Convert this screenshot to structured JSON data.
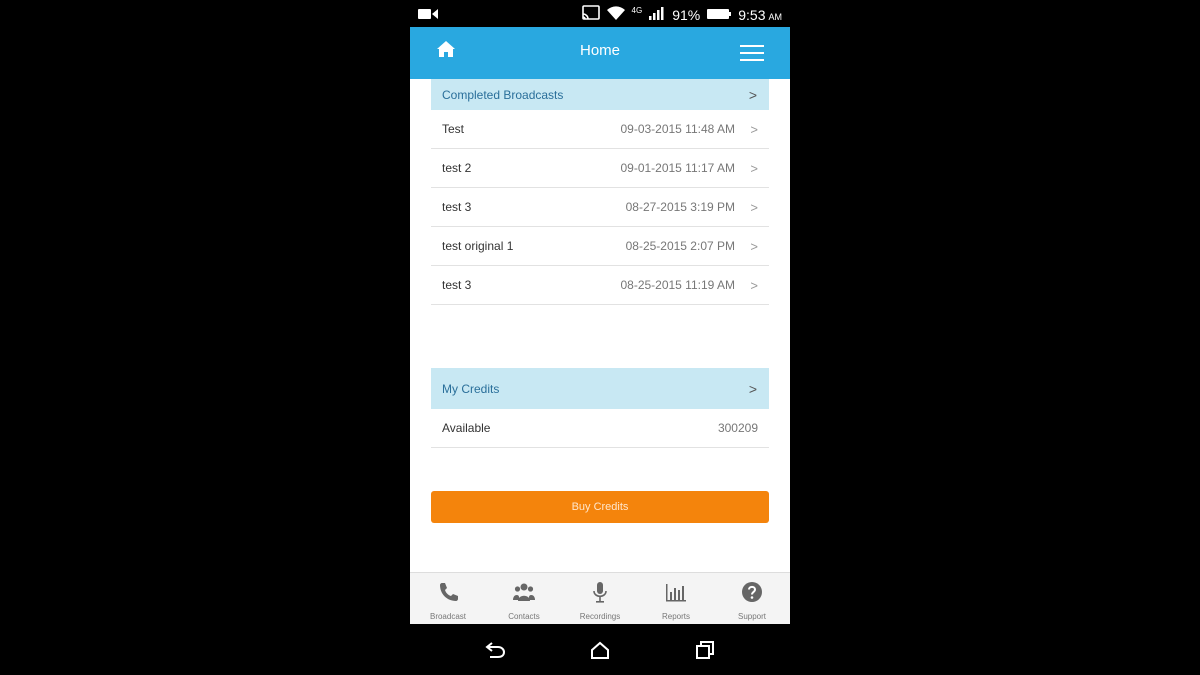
{
  "status": {
    "battery": "91%",
    "time": "9:53",
    "ampm": "AM",
    "network": "4G"
  },
  "header": {
    "title": "Home"
  },
  "completed": {
    "title": "Completed Broadcasts",
    "items": [
      {
        "name": "Test",
        "date": "09-03-2015 11:48 AM"
      },
      {
        "name": "test 2",
        "date": "09-01-2015 11:17 AM"
      },
      {
        "name": "test 3",
        "date": "08-27-2015 3:19 PM"
      },
      {
        "name": "test original 1",
        "date": "08-25-2015 2:07 PM"
      },
      {
        "name": "test 3",
        "date": "08-25-2015 11:19 AM"
      }
    ]
  },
  "credits": {
    "title": "My Credits",
    "available_label": "Available",
    "available_value": "300209",
    "buy_label": "Buy Credits"
  },
  "tabs": [
    {
      "label": "Broadcast",
      "icon": "phone-icon"
    },
    {
      "label": "Contacts",
      "icon": "people-icon"
    },
    {
      "label": "Recordings",
      "icon": "microphone-icon"
    },
    {
      "label": "Reports",
      "icon": "bar-chart-icon"
    },
    {
      "label": "Support",
      "icon": "help-icon"
    }
  ],
  "colors": {
    "header": "#29a8e0",
    "section": "#c8e8f3",
    "button": "#f4840c"
  }
}
